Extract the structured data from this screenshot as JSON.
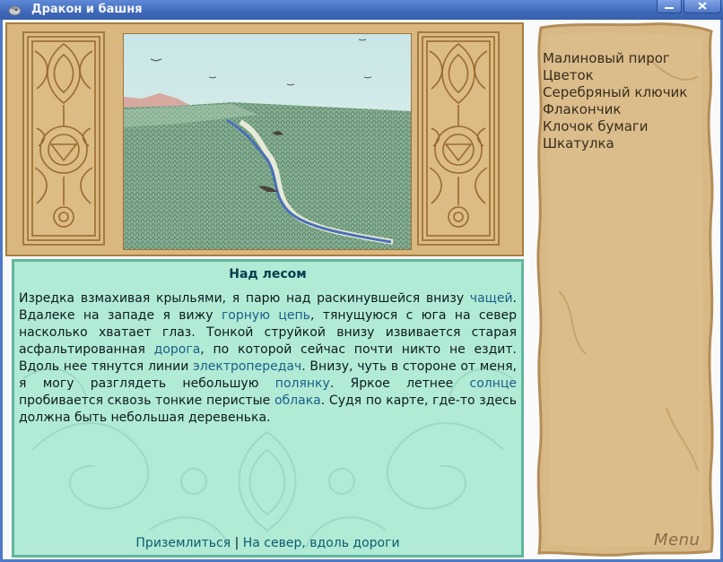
{
  "window": {
    "title": "Дракон и башня"
  },
  "scene": {
    "title": "Над лесом",
    "paragraph": [
      {
        "t": "Изредка взмахивая крыльями, я парю над раскинувшейся внизу "
      },
      {
        "t": "чащей",
        "link": true
      },
      {
        "t": ". Вдалеке на западе я вижу "
      },
      {
        "t": "горную цепь",
        "link": true
      },
      {
        "t": ", тянущуюся с юга на север насколько хватает глаз. Тонкой струйкой внизу извивается старая асфальтированная "
      },
      {
        "t": "дорога",
        "link": true
      },
      {
        "t": ", по которой сейчас почти никто не ездит. Вдоль нее тянутся линии "
      },
      {
        "t": "электропередач",
        "link": true
      },
      {
        "t": ". Внизу, чуть в стороне от меня, я могу разглядеть небольшую "
      },
      {
        "t": "полянку",
        "link": true
      },
      {
        "t": ". Яркое летнее "
      },
      {
        "t": "солнце",
        "link": true
      },
      {
        "t": " пробивается сквозь тонкие перистые "
      },
      {
        "t": "облака",
        "link": true
      },
      {
        "t": ". Судя по карте, где-то здесь должна быть небольшая деревенька."
      }
    ],
    "actions": {
      "first": "Приземлиться",
      "separator": " | ",
      "second": "На север, вдоль дороги"
    }
  },
  "inventory": {
    "items": [
      "Малиновый пирог",
      "Цветок",
      "Серебряный ключик",
      "Флакончик",
      "Клочок бумаги",
      "Шкатулка"
    ],
    "menu_label": "Menu"
  },
  "colors": {
    "titlebar": "#3f68b8",
    "frame": "#d9b77f",
    "card_bg": "#b1ebd6",
    "card_border": "#5fb79c",
    "link": "#1d5e88",
    "parchment": "#d8b985"
  },
  "icons": {
    "app": "dragon-app-icon",
    "minimize": "minimize-icon",
    "close": "close-icon"
  }
}
